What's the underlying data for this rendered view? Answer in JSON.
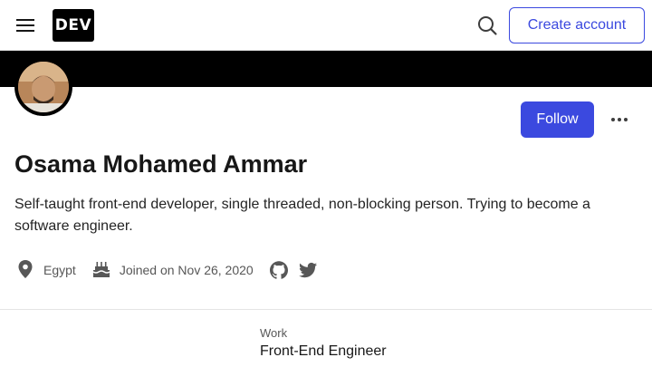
{
  "header": {
    "logo_text": "DEV",
    "create_account_label": "Create account"
  },
  "profile": {
    "name": "Osama Mohamed Ammar",
    "bio": "Self-taught front-end developer, single threaded, non-blocking person. Trying to become a software engineer.",
    "follow_label": "Follow",
    "location": "Egypt",
    "joined": "Joined on Nov 26, 2020"
  },
  "work": {
    "label": "Work",
    "value": "Front-End Engineer"
  },
  "colors": {
    "accent": "#3b49df",
    "banner": "#000000"
  }
}
